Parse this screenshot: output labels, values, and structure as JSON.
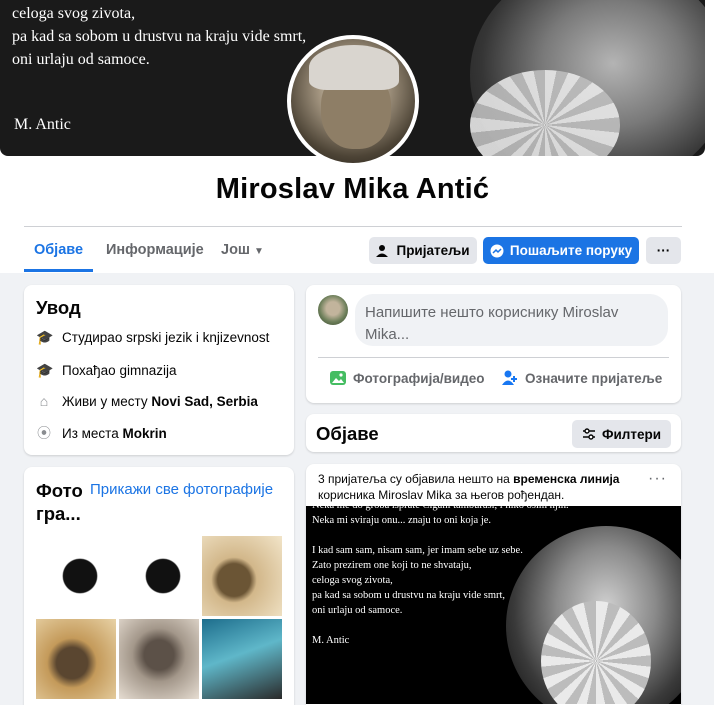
{
  "cover": {
    "quote_lines": "celoga svog zivota,\npa kad sa sobom u drustvu na kraju vide smrt,\noni urlaju od samoce.",
    "author": "M. Antic"
  },
  "profile": {
    "name": "Miroslav Mika Antić"
  },
  "tabs": [
    {
      "label": "Објаве"
    },
    {
      "label": "Информације"
    },
    {
      "label": "Још"
    }
  ],
  "actions": {
    "friends": "Пријатељи",
    "message": "Пошаљите поруку",
    "more": "···"
  },
  "intro": {
    "title": "Увод",
    "items": [
      {
        "icon": "graduation-cap-icon",
        "text": "Студирао srpski jezik i knjizevnost",
        "bold": ""
      },
      {
        "icon": "graduation-cap-icon",
        "text": "Похађао gimnazija",
        "bold": ""
      },
      {
        "icon": "home-icon",
        "text": "Живи у месту ",
        "bold": "Novi Sad, Serbia"
      },
      {
        "icon": "location-pin-icon",
        "text": "Из места ",
        "bold": "Mokrin"
      }
    ]
  },
  "photos": {
    "title_line1": "Фото",
    "title_line2": "гра...",
    "see_all": "Прикажи све фотографије"
  },
  "composer": {
    "placeholder_line1": "Напишите нешто кориснику Miroslav",
    "placeholder_line2": "Mika...",
    "photo_video": "Фотографија/видео",
    "tag_friends": "Означите пријатеље"
  },
  "posts_header": {
    "title": "Објаве",
    "filters": "Филтери"
  },
  "post": {
    "text_pre": "3 пријатеља су објавила нешто на ",
    "text_bold": "временска линија",
    "text_post": " корисника Miroslav Mika за његов рођендан.",
    "more": "···",
    "image_quote": "Neka me do groba isprate Cigani tamburasi, i niko osim njih.\nNeka mi sviraju onu... znaju to oni koja je.\n\nI kad sam sam, nisam sam, jer imam sebe uz sebe.\nZato prezirem one koji to ne shvataju,\nceloga svog zivota,\npa kad sa sobom u drustvu na kraju vide smrt,\noni urlaju od samoce.\n\nM. Antic"
  },
  "colors": {
    "accent": "#1b74e4",
    "background": "#f0f2f5",
    "secondary_text": "#65676b"
  }
}
